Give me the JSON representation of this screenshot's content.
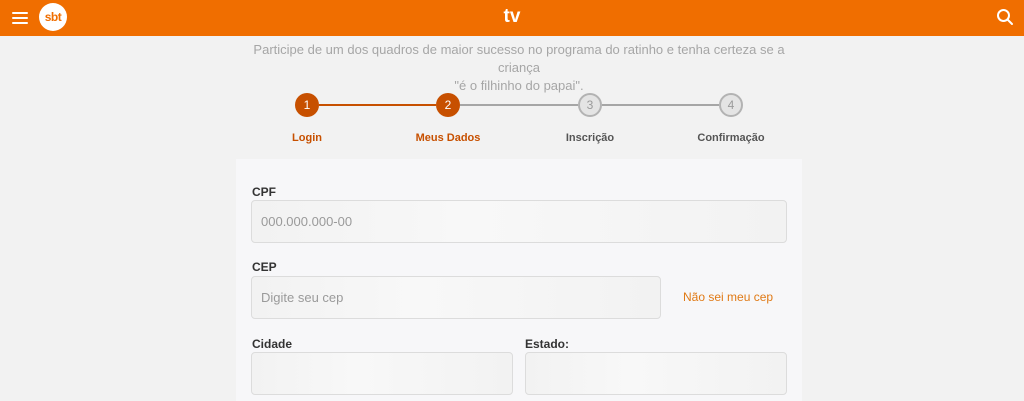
{
  "header": {
    "logo_text": "sbt",
    "title": "tv",
    "menu_icon": "hamburger-menu-icon",
    "search_icon": "search-icon",
    "color": "#f06e00"
  },
  "intro": {
    "line1": "Participe de um dos quadros de maior sucesso no programa do ratinho e tenha certeza se a criança",
    "line2": "\"é o filhinho do papai\"."
  },
  "steps": [
    {
      "number": "1",
      "label": "Login",
      "state": "active"
    },
    {
      "number": "2",
      "label": "Meus Dados",
      "state": "active"
    },
    {
      "number": "3",
      "label": "Inscrição",
      "state": "inactive"
    },
    {
      "number": "4",
      "label": "Confirmação",
      "state": "inactive"
    }
  ],
  "form": {
    "cpf": {
      "label": "CPF",
      "placeholder": "000.000.000-00",
      "value": ""
    },
    "cep": {
      "label": "CEP",
      "placeholder": "Digite seu cep",
      "value": "",
      "help_link": "Não sei meu cep"
    },
    "cidade": {
      "label": "Cidade",
      "placeholder": "",
      "value": ""
    },
    "estado": {
      "label": "Estado:",
      "placeholder": "",
      "value": ""
    }
  },
  "colors": {
    "accent": "#c75000",
    "link": "#e07a16",
    "inactive": "#b3b3b3"
  }
}
